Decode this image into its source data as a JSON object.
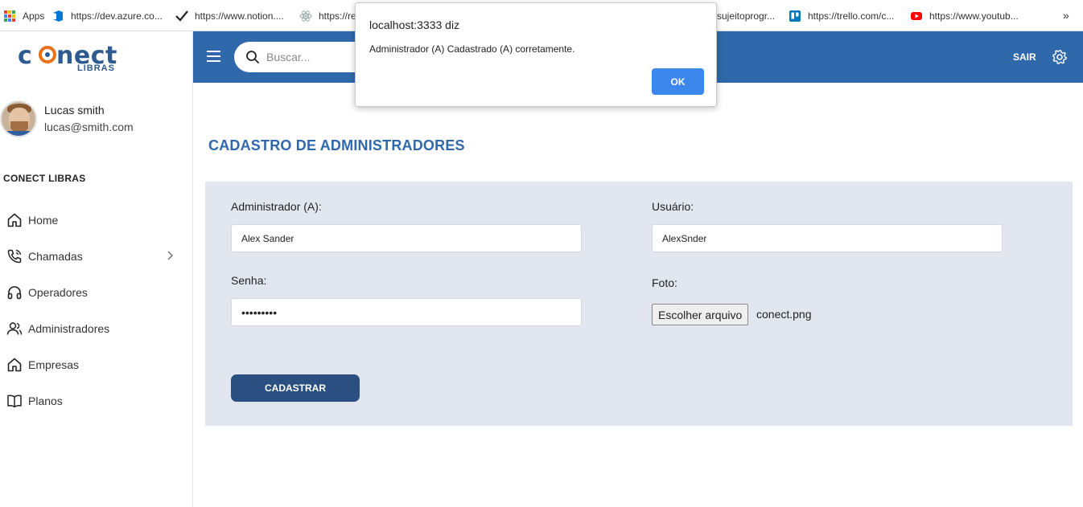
{
  "bookmarks": [
    {
      "label": "Apps",
      "icon": "apps-grid-icon"
    },
    {
      "label": "https://dev.azure.co...",
      "icon": "azure-devops-icon"
    },
    {
      "label": "https://www.notion....",
      "icon": "checkmark-icon"
    },
    {
      "label": "https://re",
      "icon": "react-icon"
    },
    {
      "label": "sujeitoprogr...",
      "icon": ""
    },
    {
      "label": "https://trello.com/c...",
      "icon": "trello-icon"
    },
    {
      "label": "https://www.youtub...",
      "icon": "youtube-icon"
    },
    {
      "label": "»",
      "icon": ""
    }
  ],
  "sidebar": {
    "logo_main": "conect",
    "logo_sub": "LIBRAS",
    "profile": {
      "name": "Lucas smith",
      "email": "lucas@smith.com"
    },
    "section_title": "CONECT LIBRAS",
    "items": [
      {
        "label": "Home",
        "icon": "home-icon"
      },
      {
        "label": "Chamadas",
        "icon": "phone-call-icon",
        "has_submenu": true
      },
      {
        "label": "Operadores",
        "icon": "headphones-icon"
      },
      {
        "label": "Administradores",
        "icon": "users-icon"
      },
      {
        "label": "Empresas",
        "icon": "building-icon"
      },
      {
        "label": "Planos",
        "icon": "book-icon"
      }
    ]
  },
  "header": {
    "search_placeholder": "Buscar...",
    "logout_label": "SAIR",
    "colors": {
      "header_bg": "#2f68ab"
    }
  },
  "main": {
    "page_title": "CADASTRO DE ADMINISTRADORES",
    "form": {
      "admin_label": "Administrador (A):",
      "admin_value": "Alex Sander",
      "user_label": "Usuário:",
      "user_value": "AlexSnder",
      "password_label": "Senha:",
      "password_value": "•••••••••",
      "photo_label": "Foto:",
      "file_button_label": "Escolher arquivo",
      "file_name": "conect.png",
      "submit_label": "CADASTRAR"
    }
  },
  "dialog": {
    "title": "localhost:3333 diz",
    "message": "Administrador (A) Cadastrado (A) corretamente.",
    "ok_label": "OK"
  }
}
